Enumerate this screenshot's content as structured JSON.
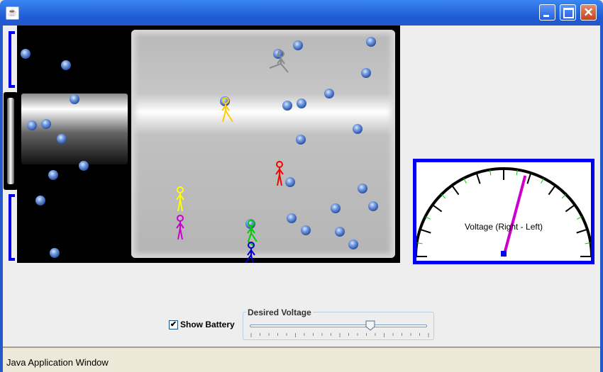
{
  "window": {
    "title": "",
    "icon": "java-cup-icon"
  },
  "title_buttons": {
    "minimize": "minimize-icon",
    "maximize": "maximize-icon",
    "close": "close-icon"
  },
  "meter": {
    "label": "Voltage (Right - Left)",
    "needle_color": "#cc00cc",
    "frame_color": "#0000ee"
  },
  "controls": {
    "show_battery": {
      "label": "Show Battery",
      "checked": true
    },
    "desired_voltage": {
      "legend": "Desired Voltage",
      "value_fraction": 0.68
    }
  },
  "status": {
    "text": "Java Application Window"
  },
  "colors": {
    "battery": "#0000ee",
    "figures": [
      "#ffff00",
      "#cc00cc",
      "#ff0000",
      "#00cc00",
      "#0000cc",
      "#ffcc00",
      "#888888"
    ]
  }
}
